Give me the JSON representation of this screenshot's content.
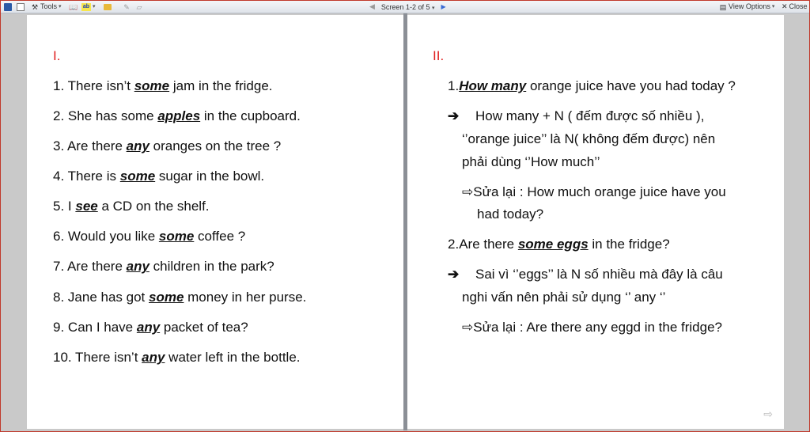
{
  "toolbar": {
    "tools_label": "Tools",
    "screen_label": "Screen 1-2 of 5",
    "view_options_label": "View Options",
    "close_label": "Close"
  },
  "left_page": {
    "heading": "I.",
    "items": [
      {
        "num": "1.",
        "pre": " There isn’t ",
        "em": "some",
        "post": "  jam in the fridge."
      },
      {
        "num": "2.",
        "pre": " She has some ",
        "em": "apples",
        "post": " in the cupboard."
      },
      {
        "num": "3.",
        "pre": " Are there ",
        "em": "any",
        "post": " oranges on the tree ?"
      },
      {
        "num": "4.",
        "pre": " There is ",
        "em": "some",
        "post": " sugar in the bowl."
      },
      {
        "num": "5.",
        "pre": " I ",
        "em": "see",
        "post": " a CD on the shelf."
      },
      {
        "num": "6.",
        "pre": " Would you like ",
        "em": "some",
        "post": " coffee ?"
      },
      {
        "num": "7.",
        "pre": " Are there ",
        "em": "any",
        "post": " children in the park?"
      },
      {
        "num": "8.",
        "pre": " Jane has got ",
        "em": "some",
        "post": " money in her purse."
      },
      {
        "num": "9.",
        "pre": " Can I have ",
        "em": "any",
        "post": " packet of tea?"
      },
      {
        "num": "10.",
        "pre": " There isn’t ",
        "em": "any",
        "post": " water left in the bottle."
      }
    ]
  },
  "right_page": {
    "heading": "II.",
    "q1": {
      "num": "1.",
      "em": "How many",
      "post": " orange juice have you had today ?"
    },
    "q1_expl": [
      "How many + N ( đếm được số nhiều ),",
      "‘’orange juice’’ là N( không đếm được) nên",
      "phải dùng ‘’How much’’"
    ],
    "q1_fix": [
      "Sửa lại : How much orange juice have you",
      "had today?"
    ],
    "q2": {
      "num": "2.",
      "pre": "Are there ",
      "em": "some eggs",
      "post": " in the fridge?"
    },
    "q2_expl": [
      "Sai vì ‘’eggs’’ là N số nhiều mà đây là câu",
      "nghi vấn nên phải sử dụng ‘’ any ‘’"
    ],
    "q2_fix": [
      "Sửa lại : Are there any eggd in the fridge?"
    ]
  }
}
